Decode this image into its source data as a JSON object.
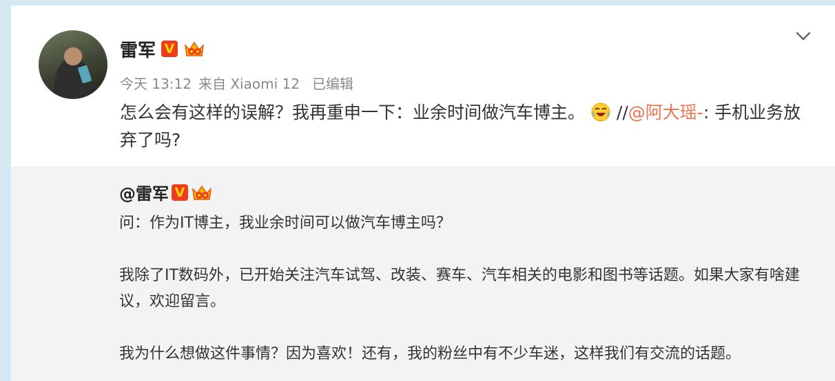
{
  "post": {
    "author": "雷军",
    "verified_badge": "V",
    "icons": {
      "verified": "verified-v-badge-icon",
      "member": "crown-member-icon",
      "expand": "chevron-down-icon",
      "emoji": "laughing-crying-emoji-icon"
    },
    "time": "今天 13:12",
    "source": "来自 Xiaomi 12",
    "edited": "已编辑",
    "text_main": "怎么会有这样的误解？我再重申一下：业余时间做汽车博主。",
    "repost_sep": "//",
    "mention": "@阿大瑶-",
    "text_after_mention": ": 手机业务放弃了吗?"
  },
  "repost": {
    "author": "@雷军",
    "verified_badge": "V",
    "paragraphs": [
      "问：作为IT博主，我业余时间可以做汽车博主吗？",
      "我除了IT数码外，已开始关注汽车试驾、改装、赛车、汽车相关的电影和图书等话题。如果大家有啥建议，欢迎留言。",
      "我为什么想做这件事情？因为喜欢！还有，我的粉丝中有不少车迷，这样我们有交流的话题。"
    ]
  },
  "colors": {
    "background": "#d6e8f3",
    "mention": "#eb7350",
    "badge_red": "#f03c1e",
    "badge_yellow": "#ffd400",
    "repost_bg": "#f3f3f3"
  }
}
